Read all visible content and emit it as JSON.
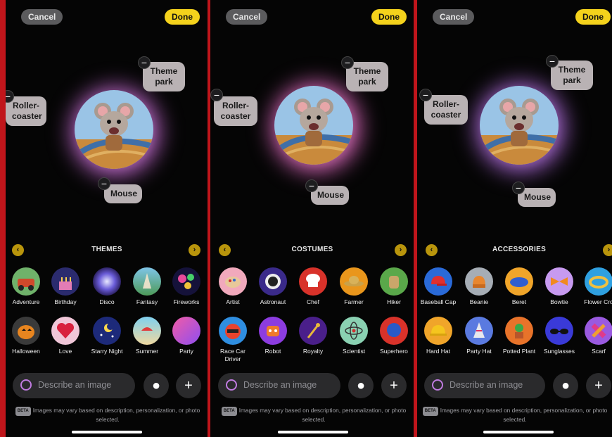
{
  "common": {
    "cancel": "Cancel",
    "done": "Done",
    "bubbles": {
      "theme_park": "Theme park",
      "roller_coaster": "Roller-coaster",
      "mouse": "Mouse"
    },
    "input_placeholder": "Describe an image",
    "beta_badge": "BETA",
    "disclaimer": "Images may vary based on description, personalization, or photo selected.",
    "prev_icon": "chevron-left-icon",
    "next_icon": "chevron-right-icon",
    "person_icon": "person-icon",
    "plus_icon": "plus-icon",
    "accent_color": "#f4d21c"
  },
  "panels": [
    {
      "section_title": "THEMES",
      "row1": [
        "Adventure",
        "Birthday",
        "Disco",
        "Fantasy",
        "Fireworks"
      ],
      "row2": [
        "Halloween",
        "Love",
        "Starry Night",
        "Summer",
        "Party"
      ]
    },
    {
      "section_title": "COSTUMES",
      "row1": [
        "Artist",
        "Astronaut",
        "Chef",
        "Farmer",
        "Hiker"
      ],
      "row2": [
        "Race Car Driver",
        "Robot",
        "Royalty",
        "Scientist",
        "Superhero"
      ]
    },
    {
      "section_title": "ACCESSORIES",
      "row1": [
        "Baseball Cap",
        "Beanie",
        "Beret",
        "Bowtie",
        "Flower Cro"
      ],
      "row2": [
        "Hard Hat",
        "Party Hat",
        "Potted Plant",
        "Sunglasses",
        "Scarf"
      ]
    }
  ]
}
